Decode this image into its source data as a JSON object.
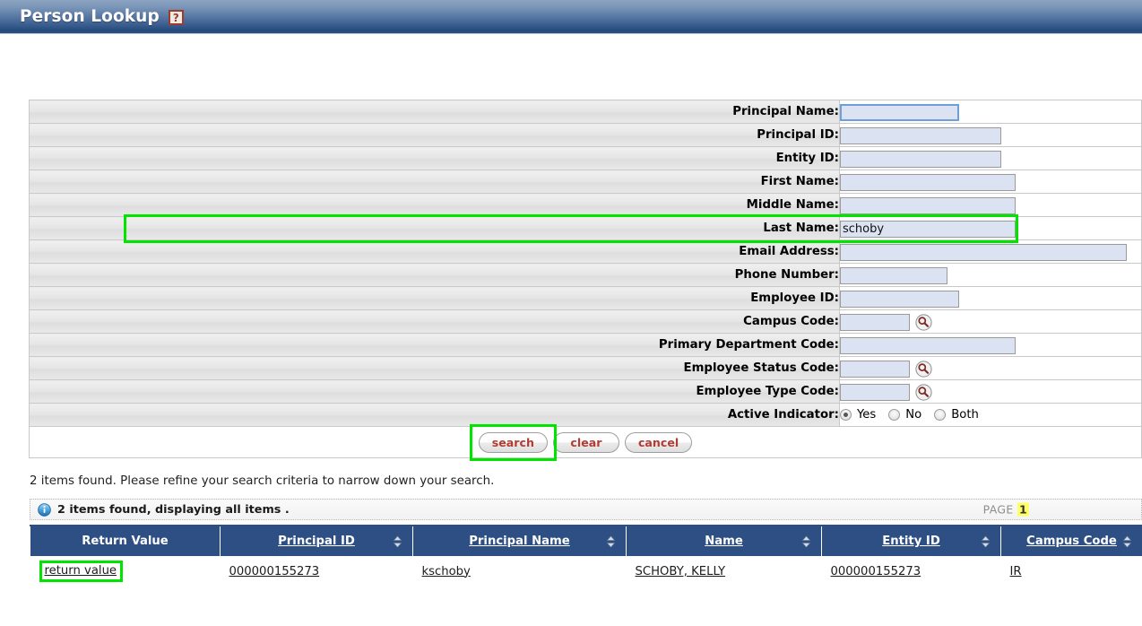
{
  "header": {
    "title": "Person Lookup",
    "help_icon": "question-help-icon",
    "help_label": "?"
  },
  "criteria": {
    "fields": [
      {
        "label": "Principal Name:",
        "value": "",
        "width": "w-lg",
        "focused": true,
        "lookup": false,
        "highlight": false
      },
      {
        "label": "Principal ID:",
        "value": "",
        "width": "w-xl",
        "focused": false,
        "lookup": false,
        "highlight": false
      },
      {
        "label": "Entity ID:",
        "value": "",
        "width": "w-xl",
        "focused": false,
        "lookup": false,
        "highlight": false
      },
      {
        "label": "First Name:",
        "value": "",
        "width": "w-xxl",
        "focused": false,
        "lookup": false,
        "highlight": false
      },
      {
        "label": "Middle Name:",
        "value": "",
        "width": "w-xxl",
        "focused": false,
        "lookup": false,
        "highlight": false
      },
      {
        "label": "Last Name:",
        "value": "schoby",
        "width": "w-xxl",
        "focused": false,
        "lookup": false,
        "highlight": true
      },
      {
        "label": "Email Address:",
        "value": "",
        "width": "w-max",
        "focused": false,
        "lookup": false,
        "highlight": false
      },
      {
        "label": "Phone Number:",
        "value": "",
        "width": "w-pn",
        "focused": false,
        "lookup": false,
        "highlight": false
      },
      {
        "label": "Employee ID:",
        "value": "",
        "width": "w-lg",
        "focused": false,
        "lookup": false,
        "highlight": false
      },
      {
        "label": "Campus Code:",
        "value": "",
        "width": "w-sm",
        "focused": false,
        "lookup": true,
        "highlight": false
      },
      {
        "label": "Primary Department Code:",
        "value": "",
        "width": "w-xxl",
        "focused": false,
        "lookup": false,
        "highlight": false
      },
      {
        "label": "Employee Status Code:",
        "value": "",
        "width": "w-sm",
        "focused": false,
        "lookup": true,
        "highlight": false
      },
      {
        "label": "Employee Type Code:",
        "value": "",
        "width": "w-sm",
        "focused": false,
        "lookup": true,
        "highlight": false
      }
    ],
    "active_indicator": {
      "label": "Active Indicator:",
      "options": [
        {
          "label": "Yes",
          "selected": true
        },
        {
          "label": "No",
          "selected": false
        },
        {
          "label": "Both",
          "selected": false
        }
      ]
    },
    "buttons": [
      {
        "label": "search",
        "highlight": true
      },
      {
        "label": "clear",
        "highlight": false
      },
      {
        "label": "cancel",
        "highlight": false
      }
    ]
  },
  "results": {
    "found_message": "2 items found. Please refine your search criteria to narrow down your search.",
    "info_message": "2 items found, displaying all items .",
    "info_icon": "info-circle-icon",
    "page_label": "PAGE",
    "page_number": "1",
    "columns": [
      {
        "label": "Return Value",
        "sortable": false
      },
      {
        "label": "Principal ID",
        "sortable": true
      },
      {
        "label": "Principal Name",
        "sortable": true
      },
      {
        "label": "Name",
        "sortable": true
      },
      {
        "label": "Entity ID",
        "sortable": true
      },
      {
        "label": "Campus Code",
        "sortable": true
      }
    ],
    "rows": [
      {
        "return_value": "return value",
        "principal_id": "000000155273",
        "principal_name": "kschoby",
        "name": "SCHOBY, KELLY",
        "entity_id": "000000155273",
        "campus_code": "IR",
        "highlight_return": true
      }
    ]
  },
  "colors": {
    "title_bar_top": "#8ca3c1",
    "title_bar_bottom": "#274a7e",
    "input_fill": "#dbe2f1",
    "table_header": "#2e4f84",
    "button_text": "#b23b32",
    "annotation_green": "#00e400",
    "page_highlight": "#ffff66"
  }
}
